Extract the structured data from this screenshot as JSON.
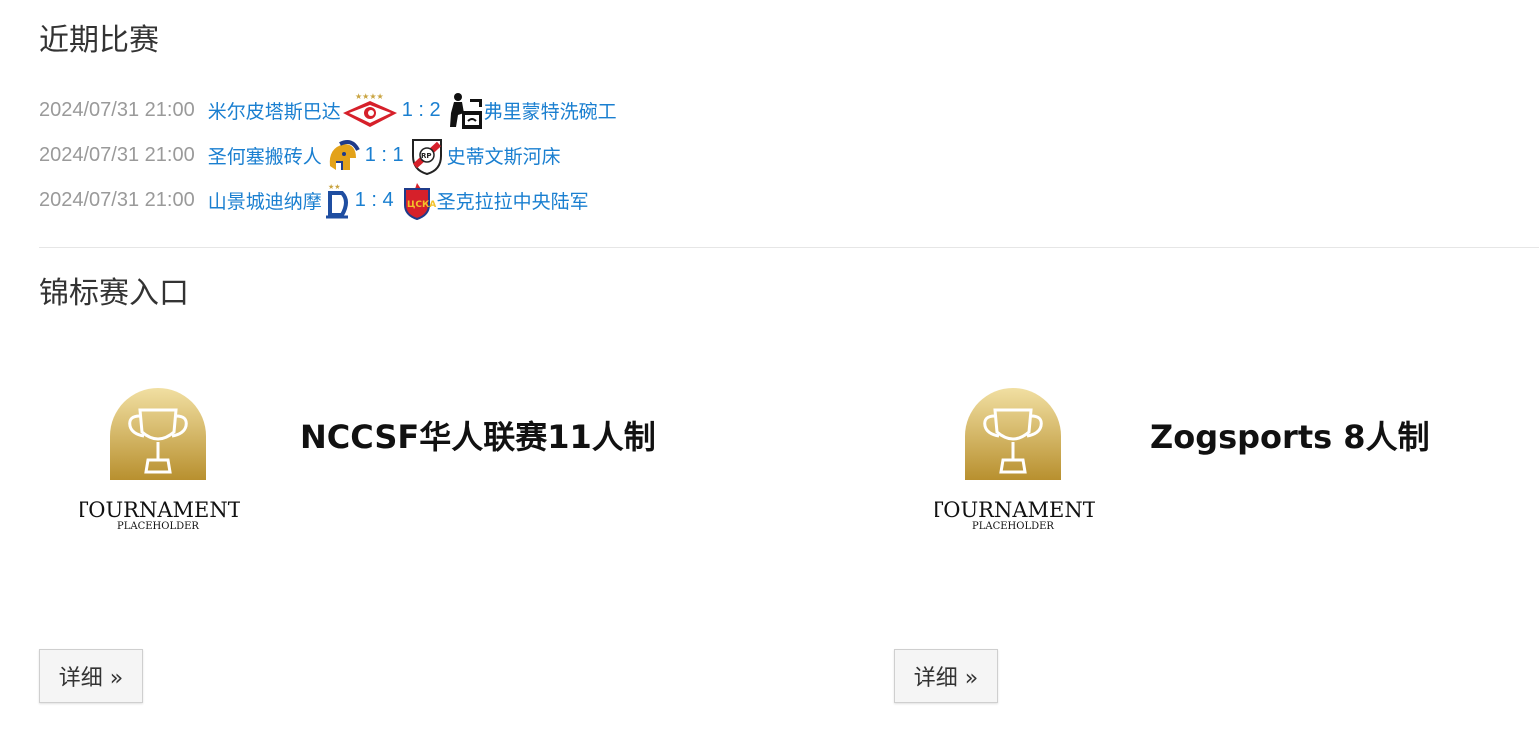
{
  "recent": {
    "title": "近期比赛",
    "matches": [
      {
        "date": "2024/07/31 21:00",
        "home": "米尔皮塔斯巴达",
        "score": "1 : 2",
        "away": "弗里蒙特洗碗工",
        "home_logo": "spartak-logo",
        "away_logo": "dishwasher-logo"
      },
      {
        "date": "2024/07/31 21:00",
        "home": "圣何塞搬砖人",
        "score": "1 : 1",
        "away": "史蒂文斯河床",
        "home_logo": "spartan-helmet-logo",
        "away_logo": "river-plate-logo"
      },
      {
        "date": "2024/07/31 21:00",
        "home": "山景城迪纳摩",
        "score": "1 : 4",
        "away": "圣克拉拉中央陆军",
        "home_logo": "dynamo-logo",
        "away_logo": "cska-logo"
      }
    ]
  },
  "tournaments": {
    "title": "锦标赛入口",
    "cards": [
      {
        "name": "NCCSF华人联赛11人制",
        "logo_line1": "TOURNAMENT",
        "logo_line2": "PLACEHOLDER",
        "button": "详细 »"
      },
      {
        "name": "Zogsports 8人制",
        "logo_line1": "TOURNAMENT",
        "logo_line2": "PLACEHOLDER",
        "button": "详细 »"
      }
    ]
  },
  "colors": {
    "link": "#1a7fd0",
    "date": "#9a9a9a",
    "gold": "#c9a441"
  }
}
